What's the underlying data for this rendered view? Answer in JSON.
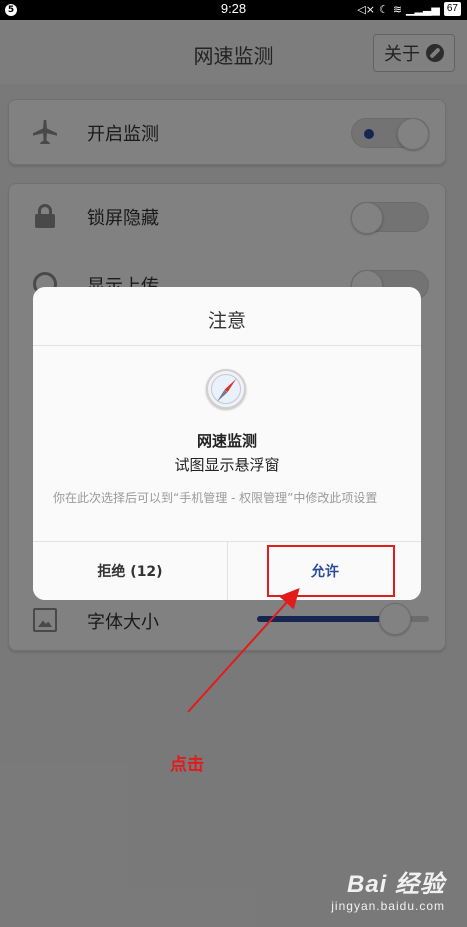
{
  "status_bar": {
    "time": "9:28",
    "battery": "67"
  },
  "header": {
    "title": "网速监测",
    "about_label": "关于"
  },
  "settings": {
    "enable_monitor": {
      "label": "开启监测",
      "icon": "airplane-icon",
      "on": true
    },
    "lock_hide": {
      "label": "锁屏隐藏",
      "icon": "lock-icon",
      "on": false
    },
    "show_upload": {
      "label": "显示上传",
      "icon": "eye-icon",
      "on": false
    },
    "font_size": {
      "label": "字体大小",
      "icon": "image-icon",
      "level": 0.8
    }
  },
  "dialog": {
    "title": "注意",
    "app_icon": "safari-compass-icon",
    "app_name": "网速监测",
    "request": "试图显示悬浮窗",
    "hint": "你在此次选择后可以到“手机管理 - 权限管理”中修改此项设置",
    "deny_label": "拒绝 (12)",
    "allow_label": "允许"
  },
  "annotation": {
    "note": "点击",
    "color": "#e21b1b"
  },
  "watermark": {
    "brand": "Bai  经验",
    "url": "jingyan.baidu.com"
  },
  "colors": {
    "accent": "#2a4a9b",
    "background": "#e9e9e9"
  }
}
